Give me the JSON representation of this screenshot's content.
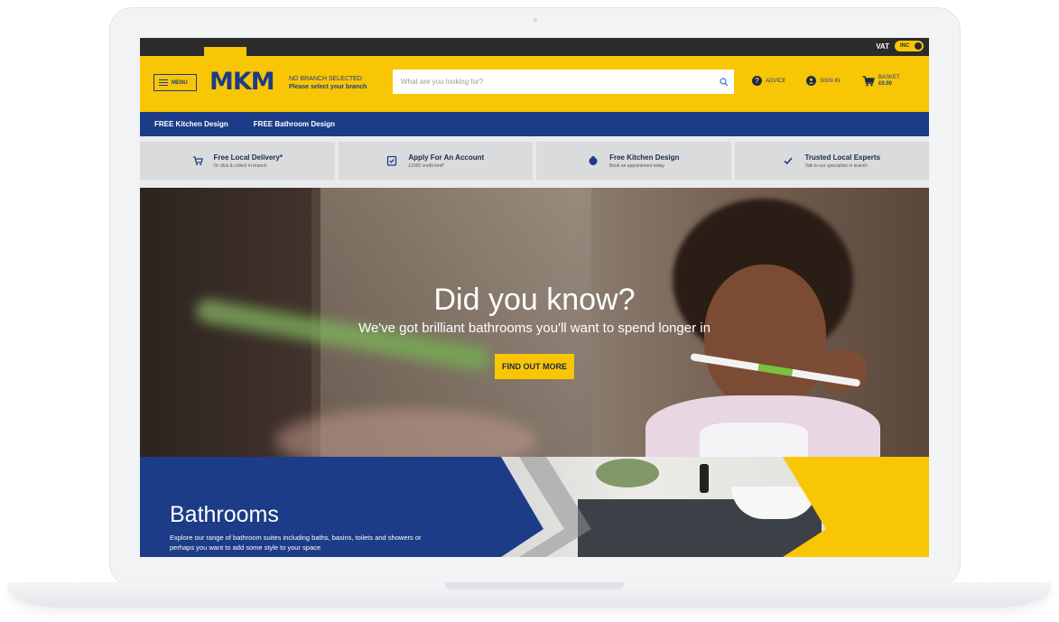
{
  "topbar": {
    "vat_label": "VAT",
    "vat_toggle": "INC"
  },
  "header": {
    "menu_label": "MENU",
    "logo_text": "MKM",
    "branch_line1": "NO BRANCH SELECTED",
    "branch_line2": "Please select your branch",
    "search_placeholder": "What are you looking for?",
    "advice_label": "ADVICE",
    "signin_label": "SIGN IN",
    "basket_label": "BASKET",
    "basket_total": "£0.00"
  },
  "nav": {
    "items": [
      "FREE Kitchen Design",
      "FREE Bathroom Design"
    ]
  },
  "benefits": [
    {
      "title": "Free Local Delivery*",
      "subtitle": "Or click & collect in branch",
      "icon": "cart-icon"
    },
    {
      "title": "Apply For An Account",
      "subtitle": "£1000 credit limit*",
      "icon": "clipboard-icon"
    },
    {
      "title": "Free Kitchen Design",
      "subtitle": "Book an appointment today",
      "icon": "kitchen-icon"
    },
    {
      "title": "Trusted Local Experts",
      "subtitle": "Talk to our specialists in branch",
      "icon": "check-icon"
    }
  ],
  "hero": {
    "title": "Did you know?",
    "subtitle": "We've got brilliant bathrooms you'll want to spend longer in",
    "cta_label": "FIND OUT MORE"
  },
  "banner": {
    "title": "Bathrooms",
    "description": "Explore our range of bathroom suites including baths, basins, toilets and showers or perhaps you want to add some style to your space"
  },
  "colors": {
    "brand_yellow": "#f8c605",
    "brand_blue": "#1d3c87",
    "topbar": "#2b2b2b"
  }
}
